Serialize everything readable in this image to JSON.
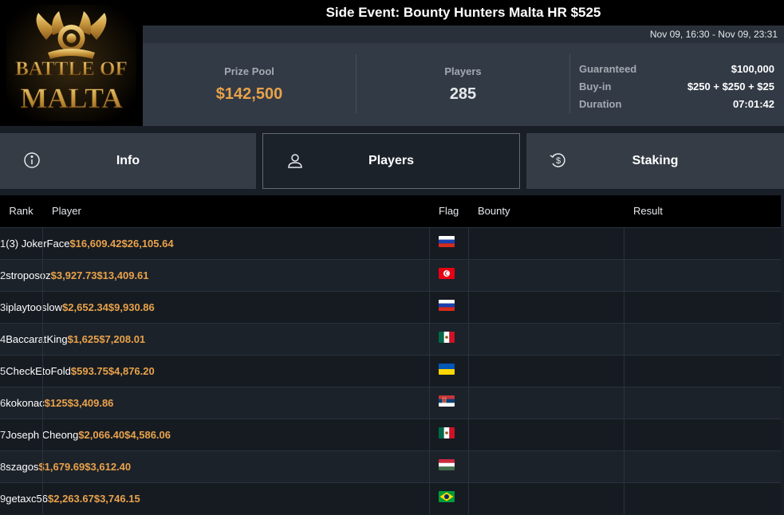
{
  "logo": {
    "line1": "BATTLE OF",
    "line2": "MALTA"
  },
  "header": {
    "title": "Side Event: Bounty Hunters Malta HR $525",
    "dates": "Nov 09, 16:30 - Nov 09, 23:31"
  },
  "stats": {
    "prize_pool_label": "Prize Pool",
    "prize_pool_value": "$142,500",
    "players_label": "Players",
    "players_value": "285",
    "guaranteed_label": "Guaranteed",
    "guaranteed_value": "$100,000",
    "buyin_label": "Buy-in",
    "buyin_value": "$250 + $250 + $25",
    "duration_label": "Duration",
    "duration_value": "07:01:42"
  },
  "tabs": [
    {
      "label": "Info",
      "icon": "info-icon",
      "active": false
    },
    {
      "label": "Players",
      "icon": "user-icon",
      "active": true
    },
    {
      "label": "Staking",
      "icon": "staking-icon",
      "active": false
    }
  ],
  "table": {
    "headers": {
      "rank": "Rank",
      "player": "Player",
      "flag": "Flag",
      "bounty": "Bounty",
      "result": "Result"
    },
    "rows": [
      {
        "rank": "1",
        "player": "(3) JokerFace",
        "flag": "russia",
        "bounty": "$16,609.42",
        "result": "$26,105.64"
      },
      {
        "rank": "2",
        "player": "stroposoz",
        "flag": "tunisia",
        "bounty": "$3,927.73",
        "result": "$13,409.61"
      },
      {
        "rank": "3",
        "player": "iplaytooslow",
        "flag": "russia",
        "bounty": "$2,652.34",
        "result": "$9,930.86"
      },
      {
        "rank": "4",
        "player": "BaccaratKing",
        "flag": "mexico",
        "bounty": "$1,625",
        "result": "$7,208.01"
      },
      {
        "rank": "5",
        "player": "CheckEtoFold",
        "flag": "ukraine",
        "bounty": "$593.75",
        "result": "$4,876.20"
      },
      {
        "rank": "6",
        "player": "kokonac",
        "flag": "serbia",
        "bounty": "$125",
        "result": "$3,409.86"
      },
      {
        "rank": "7",
        "player": "Joseph Cheong",
        "flag": "mexico",
        "bounty": "$2,066.40",
        "result": "$4,586.06"
      },
      {
        "rank": "8",
        "player": "szagos",
        "flag": "hungary",
        "bounty": "$1,679.69",
        "result": "$3,612.40"
      },
      {
        "rank": "9",
        "player": "getaxc56",
        "flag": "brazil",
        "bounty": "$2,263.67",
        "result": "$3,746.15"
      }
    ]
  },
  "colors": {
    "accent": "#e9a24a",
    "header_black": "#000000",
    "panel": "#323a45"
  }
}
